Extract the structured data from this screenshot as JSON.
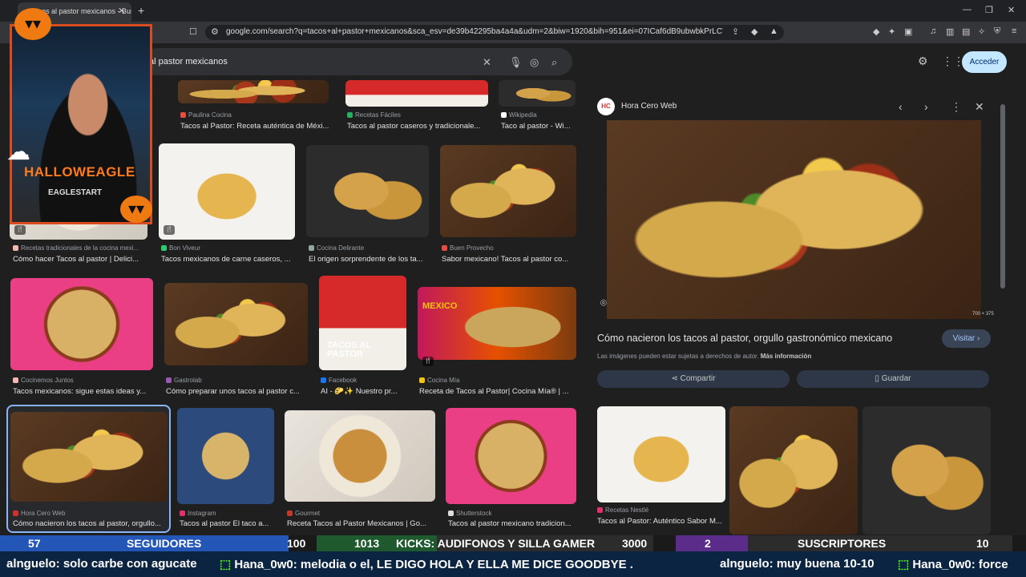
{
  "browser": {
    "tab_title": "tacos al pastor mexicanos - Bus",
    "url": "google.com/search?q=tacos+al+pastor+mexicanos&sca_esv=de39b42295ba4a4a&udm=2&biw=1920&bih=951&ei=07ICaf6dB9ubwbkPrLC7mQI&..."
  },
  "search": {
    "query": "al pastor mexicanos",
    "signin_label": "Acceder"
  },
  "results": {
    "row0": [
      {
        "source": "Paulina Cocina",
        "caption": "Tacos al Pastor: Receta auténtica de Méxi..."
      },
      {
        "source": "Recetas Fáciles",
        "caption": "Tacos al pastor caseros y tradicionale..."
      },
      {
        "source": "Wikipedia",
        "caption": "Taco al pastor - Wi..."
      }
    ],
    "row1": [
      {
        "source": "Recetas tradicionales de la cocina mexi...",
        "caption": "Cómo hacer Tacos al pastor | Delici..."
      },
      {
        "source": "Bon Viveur",
        "caption": "Tacos mexicanos de carne caseros, ..."
      },
      {
        "source": "Cocina Delirante",
        "caption": "El origen sorprendente de los ta..."
      },
      {
        "source": "Buen Provecho",
        "caption": "Sabor mexicano! Tacos al pastor co..."
      }
    ],
    "row2": [
      {
        "source": "Cocinemos Juntos",
        "caption": "Tacos mexicanos: sigue estas ideas y..."
      },
      {
        "source": "Gastrolab",
        "caption": "Cómo preparar unos tacos al pastor c..."
      },
      {
        "source": "Facebook",
        "caption": "AI - 🌮✨ Nuestro pr..."
      },
      {
        "source": "Cocina Mía",
        "caption": "Receta de Tacos al Pastor| Cocina Mía® | ..."
      }
    ],
    "row3": [
      {
        "source": "Hora Cero Web",
        "caption": "Cómo nacieron los tacos al pastor, orgullo..."
      },
      {
        "source": "Instagram",
        "caption": "Tacos al pastor El taco a..."
      },
      {
        "source": "Gourmet",
        "caption": "Receta Tacos al Pastor Mexicanos | Go..."
      },
      {
        "source": "Shutterstock",
        "caption": "Tacos al pastor mexicano tradicion..."
      }
    ],
    "red_card_text": "TACOS AL PASTOR",
    "mex_card_text": "MEXICO"
  },
  "panel": {
    "site": "Hora Cero Web",
    "logo_text": "HC",
    "dimensions": "700 × 375",
    "title": "Cómo nacieron los tacos al pastor, orgullo gastronómico mexicano",
    "visit_label": "Visitar",
    "rights_text": "Las imágenes pueden estar sujetas a derechos de autor.",
    "rights_link": "Más información",
    "share_label": "Compartir",
    "save_label": "Guardar",
    "related_source": "Recetas Nestlé",
    "related_caption": "Tacos al Pastor: Auténtico Sabor M..."
  },
  "overlay": {
    "brand": "HALLOWEAGLE",
    "channel": "EAGLESTART"
  },
  "stats": {
    "a_value": "57",
    "a_label": "SEGUIDORES",
    "a_goal": "100",
    "b_value": "1013",
    "b_label": "KICKS: AUDIFONOS Y SILLA GAMER",
    "b_goal": "3000",
    "c_value": "2",
    "c_label": "SUSCRIPTORES",
    "c_goal": "10"
  },
  "chat": {
    "m1_user": "alnguelo",
    "m1_text": ": solo carbe con agucate",
    "m2_user": "Hana_0w0",
    "m2_text": ": melodia o el, LE DIGO HOLA Y ELLA ME DICE GOODBYE .",
    "m3_user": "alnguelo",
    "m3_text": ": muy buena 10-10",
    "m4_user": "Hana_0w0",
    "m4_text": ": force"
  }
}
